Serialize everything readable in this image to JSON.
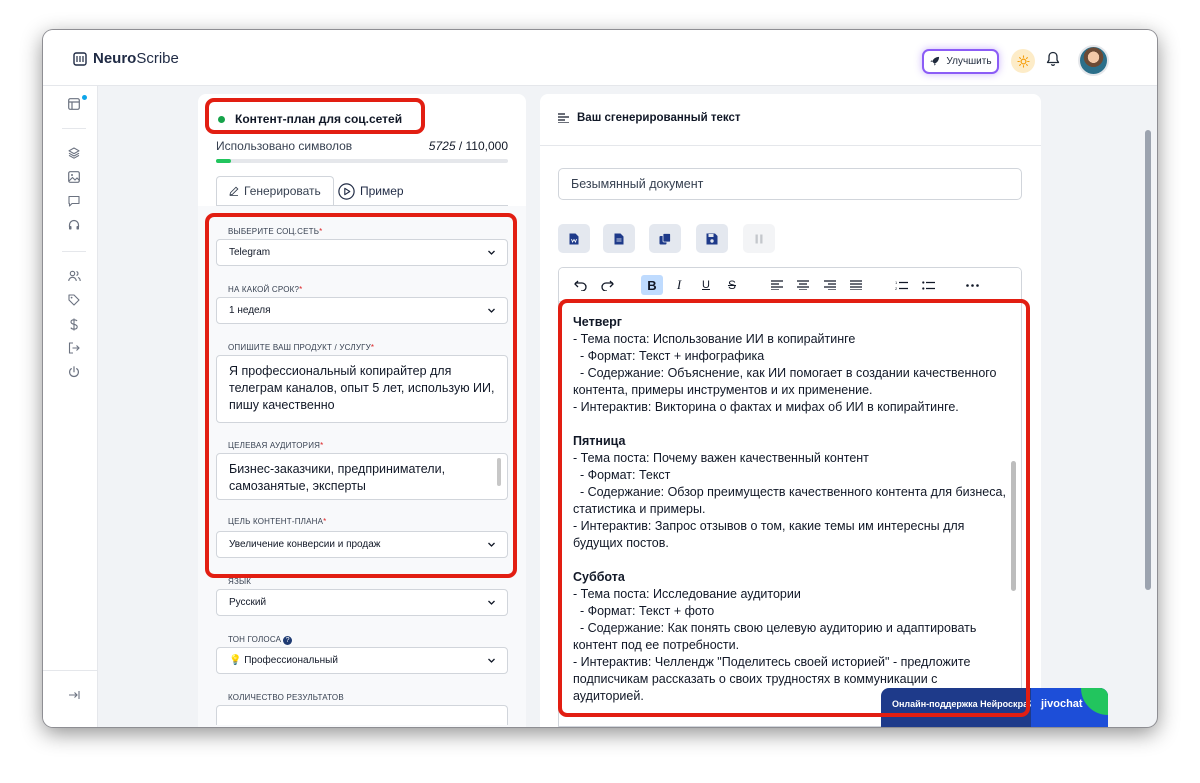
{
  "header": {
    "logo_bold": "Neuro",
    "logo_rest": "Scribe",
    "upgrade_label": "Улучшить"
  },
  "left": {
    "title": "Контент-план для соц.сетей",
    "usage_label": "Использовано символов",
    "usage_used": "5725",
    "usage_total": "/ 110,000",
    "usage_fraction": 0.052,
    "tab_generate": "Генерировать",
    "tab_example": "Пример",
    "fields": {
      "social_label": "Выберите соц.сеть",
      "social_value": "Telegram",
      "period_label": "На какой срок?",
      "period_value": "1 неделя",
      "product_label": "Опишите ваш продукт / услугу",
      "product_value": "Я профессиональный копирайтер для телеграм каналов, опыт 5 лет, использую ИИ, пишу качественно",
      "audience_label": "Целевая аудитория",
      "audience_value": "Бизнес-заказчики, предприниматели, самозанятые, эксперты",
      "goal_label": "Цель контент-плана",
      "goal_value": "Увеличение конверсии и продаж",
      "lang_label": "Язык",
      "lang_value": "Русский",
      "tone_label": "Тон голоса",
      "tone_value": "💡 Профессиональный",
      "count_label": "Количество результатов"
    }
  },
  "right": {
    "title": "Ваш сгенерированный текст",
    "doc_name": "Безымянный документ",
    "content": {
      "thu_title": "Четверг",
      "thu_1": "- Тема поста: Использование ИИ в копирайтинге",
      "thu_2": "  - Формат: Текст + инфографика",
      "thu_3": "  - Содержание: Объяснение, как ИИ помогает в создании качественного контента, примеры инструментов и их применение.",
      "thu_4": "- Интерактив: Викторина о фактах и мифах об ИИ в копирайтинге.",
      "fri_title": "Пятница",
      "fri_1": "- Тема поста: Почему важен качественный контент",
      "fri_2": "  - Формат: Текст",
      "fri_3": "  - Содержание: Обзор преимуществ качественного контента для бизнеса, статистика и примеры.",
      "fri_4": "- Интерактив: Запрос отзывов о том, какие темы им интересны для будущих постов.",
      "sat_title": "Суббота",
      "sat_1": "- Тема поста: Исследование аудитории",
      "sat_2": "  - Формат: Текст + фото",
      "sat_3": "  - Содержание: Как понять свою целевую аудиторию и адаптировать контент под ее потребности.",
      "sat_4": "- Интерактив: Челлендж \"Поделитесь своей историей\" - предложите подписчикам рассказать о своих трудностях в коммуникации с аудиторией."
    }
  },
  "chat": {
    "text": "Онлайн-поддержка Нейроскрайб",
    "brand": "jivochat"
  }
}
